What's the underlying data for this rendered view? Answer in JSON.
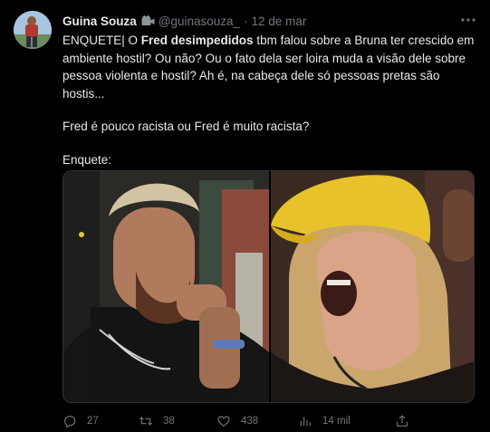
{
  "user": {
    "name": "Guina Souza",
    "handle": "@guinasouza_",
    "separator": "·",
    "date": "12 de mar"
  },
  "tweet": {
    "line1_a": "ENQUETE| O ",
    "line1_b": "Fred desimpedidos",
    "line1_c": " tbm falou sobre a Bruna ter crescido em ambiente hostil? Ou não? Ou o fato dela ser loira muda a visão dele sobre pessoa violenta e hostil? Ah é, na cabeça dele só pessoas pretas são hostis...",
    "question": "Fred é pouco racista ou Fred é muito racista?",
    "poll_label": "Enquete:"
  },
  "stats": {
    "replies": "27",
    "retweets": "38",
    "likes": "438",
    "views": "14 mil"
  },
  "icons": {
    "more": "more-dots-icon",
    "camera": "camera-emoji-icon",
    "reply": "reply-icon",
    "retweet": "retweet-icon",
    "like": "heart-icon",
    "views": "views-chart-icon",
    "share": "share-icon"
  },
  "colors": {
    "background": "#000000",
    "text": "#e7e9ea",
    "muted": "#71767b"
  }
}
